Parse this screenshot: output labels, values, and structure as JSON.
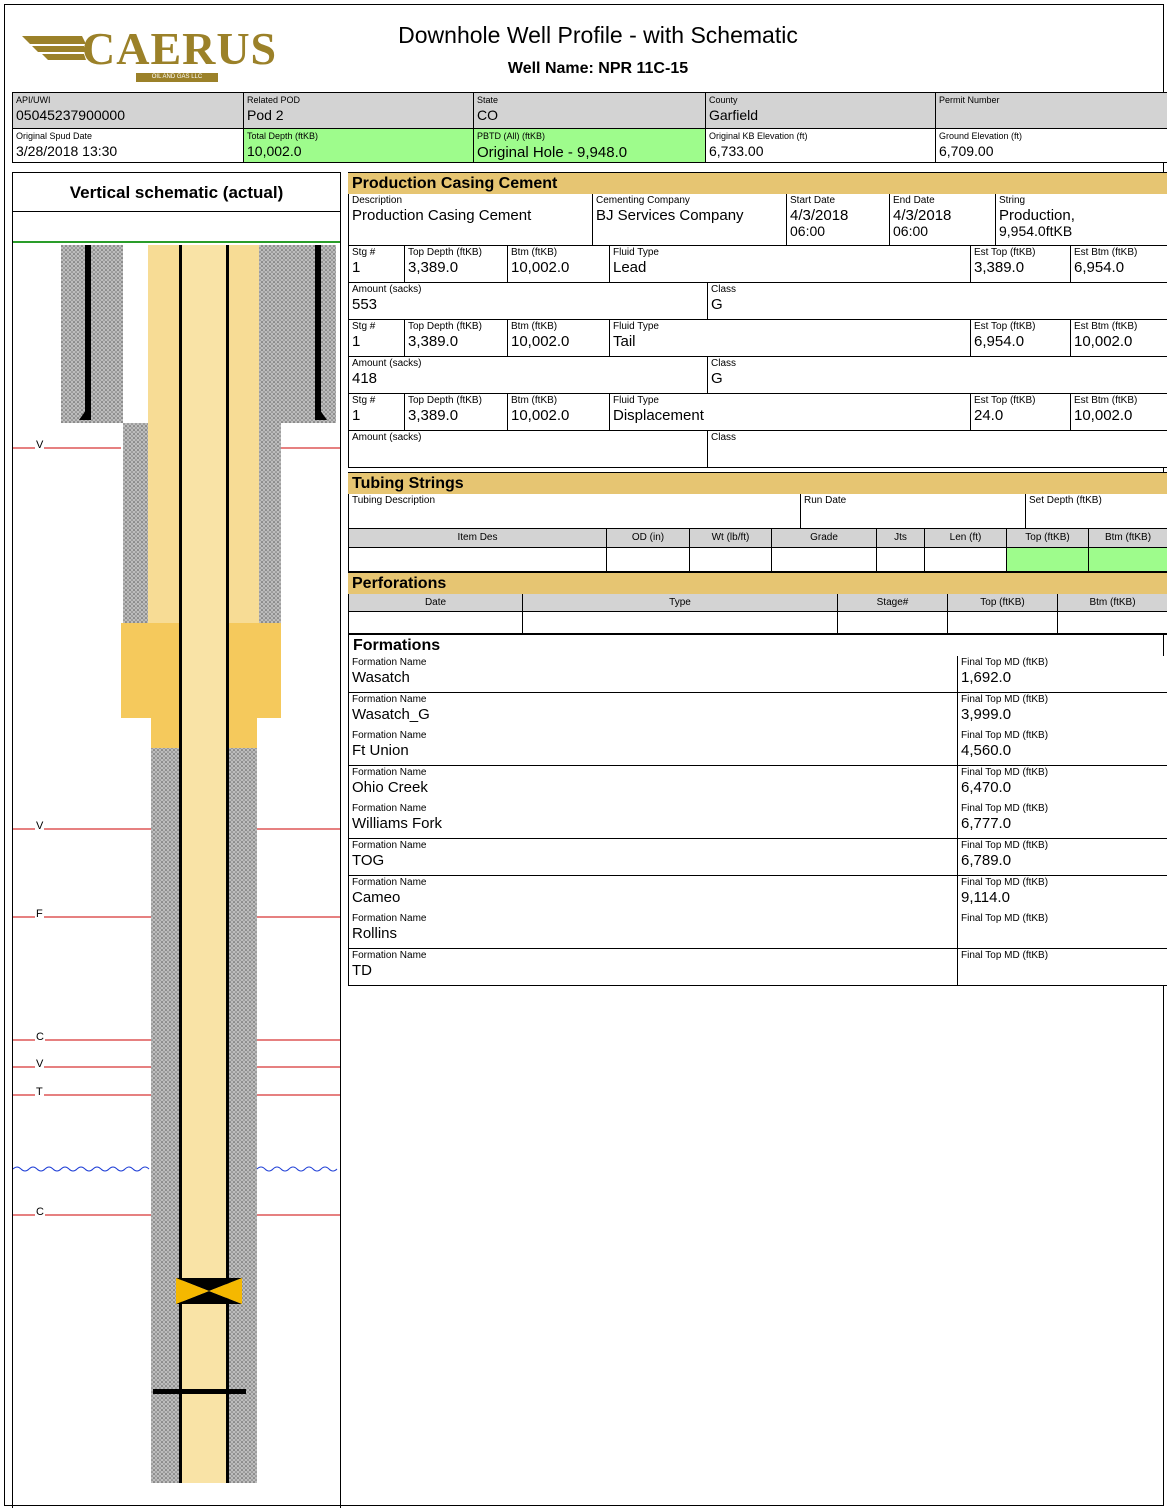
{
  "header": {
    "logo_text": "CAERUS",
    "logo_sub": "OIL AND GAS LLC",
    "title": "Downhole Well Profile - with Schematic",
    "well_name": "Well Name: NPR 11C-15",
    "fields": [
      {
        "label": "API/UWI",
        "value": "05045237900000"
      },
      {
        "label": "Related POD",
        "value": "Pod 2"
      },
      {
        "label": "State",
        "value": "CO"
      },
      {
        "label": "County",
        "value": "Garfield"
      },
      {
        "label": "Permit Number",
        "value": ""
      },
      {
        "label": "Original Spud Date",
        "value": "3/28/2018 13:30"
      },
      {
        "label": "Total Depth (ftKB)",
        "value": "10,002.0"
      },
      {
        "label": "PBTD (All) (ftKB)",
        "value": "Original Hole - 9,948.0"
      },
      {
        "label": "Original KB Elevation (ft)",
        "value": "6,733.00"
      },
      {
        "label": "Ground Elevation (ft)",
        "value": "6,709.00"
      }
    ]
  },
  "schematic": {
    "title": "Vertical schematic (actual)",
    "markers": [
      "V",
      "V",
      "F",
      "C",
      "V",
      "T",
      "C"
    ]
  },
  "cement": {
    "title": "Production Casing Cement",
    "description_label": "Description",
    "description": "Production Casing Cement",
    "company_label": "Cementing Company",
    "company": "BJ Services Company",
    "start_label": "Start Date",
    "start_date": "4/3/2018",
    "start_time": "06:00",
    "end_label": "End Date",
    "end_date": "4/3/2018",
    "end_time": "06:00",
    "string_label": "String",
    "string_1": "Production,",
    "string_2": "9,954.0ftKB",
    "labels": {
      "stg": "Stg #",
      "top": "Top Depth (ftKB)",
      "btm": "Btm (ftKB)",
      "fluid": "Fluid Type",
      "est_top": "Est Top (ftKB)",
      "est_btm": "Est Btm (ftKB)",
      "amount": "Amount (sacks)",
      "class": "Class"
    },
    "stages": [
      {
        "stg": "1",
        "top": "3,389.0",
        "btm": "10,002.0",
        "fluid": "Lead",
        "est_top": "3,389.0",
        "est_btm": "6,954.0",
        "amount": "553",
        "class": "G"
      },
      {
        "stg": "1",
        "top": "3,389.0",
        "btm": "10,002.0",
        "fluid": "Tail",
        "est_top": "6,954.0",
        "est_btm": "10,002.0",
        "amount": "418",
        "class": "G"
      },
      {
        "stg": "1",
        "top": "3,389.0",
        "btm": "10,002.0",
        "fluid": "Displacement",
        "est_top": "24.0",
        "est_btm": "10,002.0",
        "amount": "",
        "class": ""
      }
    ]
  },
  "tubing": {
    "title": "Tubing Strings",
    "desc_label": "Tubing Description",
    "run_label": "Run Date",
    "set_label": "Set Depth (ftKB)",
    "columns": [
      "Item Des",
      "OD (in)",
      "Wt (lb/ft)",
      "Grade",
      "Jts",
      "Len (ft)",
      "Top (ftKB)",
      "Btm (ftKB)"
    ]
  },
  "perforations": {
    "title": "Perforations",
    "columns": [
      "Date",
      "Type",
      "Stage#",
      "Top (ftKB)",
      "Btm (ftKB)"
    ]
  },
  "formations": {
    "title": "Formations",
    "name_label": "Formation Name",
    "top_label": "Final Top MD (ftKB)",
    "items": [
      {
        "name": "Wasatch",
        "top": "1,692.0"
      },
      {
        "name": "Wasatch_G",
        "top": "3,999.0"
      },
      {
        "name": "Ft Union",
        "top": "4,560.0"
      },
      {
        "name": "Ohio Creek",
        "top": "6,470.0"
      },
      {
        "name": "Williams Fork",
        "top": "6,777.0"
      },
      {
        "name": "TOG",
        "top": "6,789.0"
      },
      {
        "name": "Cameo",
        "top": "9,114.0"
      },
      {
        "name": "Rollins",
        "top": ""
      },
      {
        "name": "TD",
        "top": ""
      }
    ]
  },
  "colors": {
    "section_header": "#e6c572",
    "label_bg": "#d3d3d3",
    "highlight": "#9efc8c",
    "cement": "#f5c95c",
    "tubing": "#f9e3a6",
    "marker_line": "#cc0000"
  }
}
